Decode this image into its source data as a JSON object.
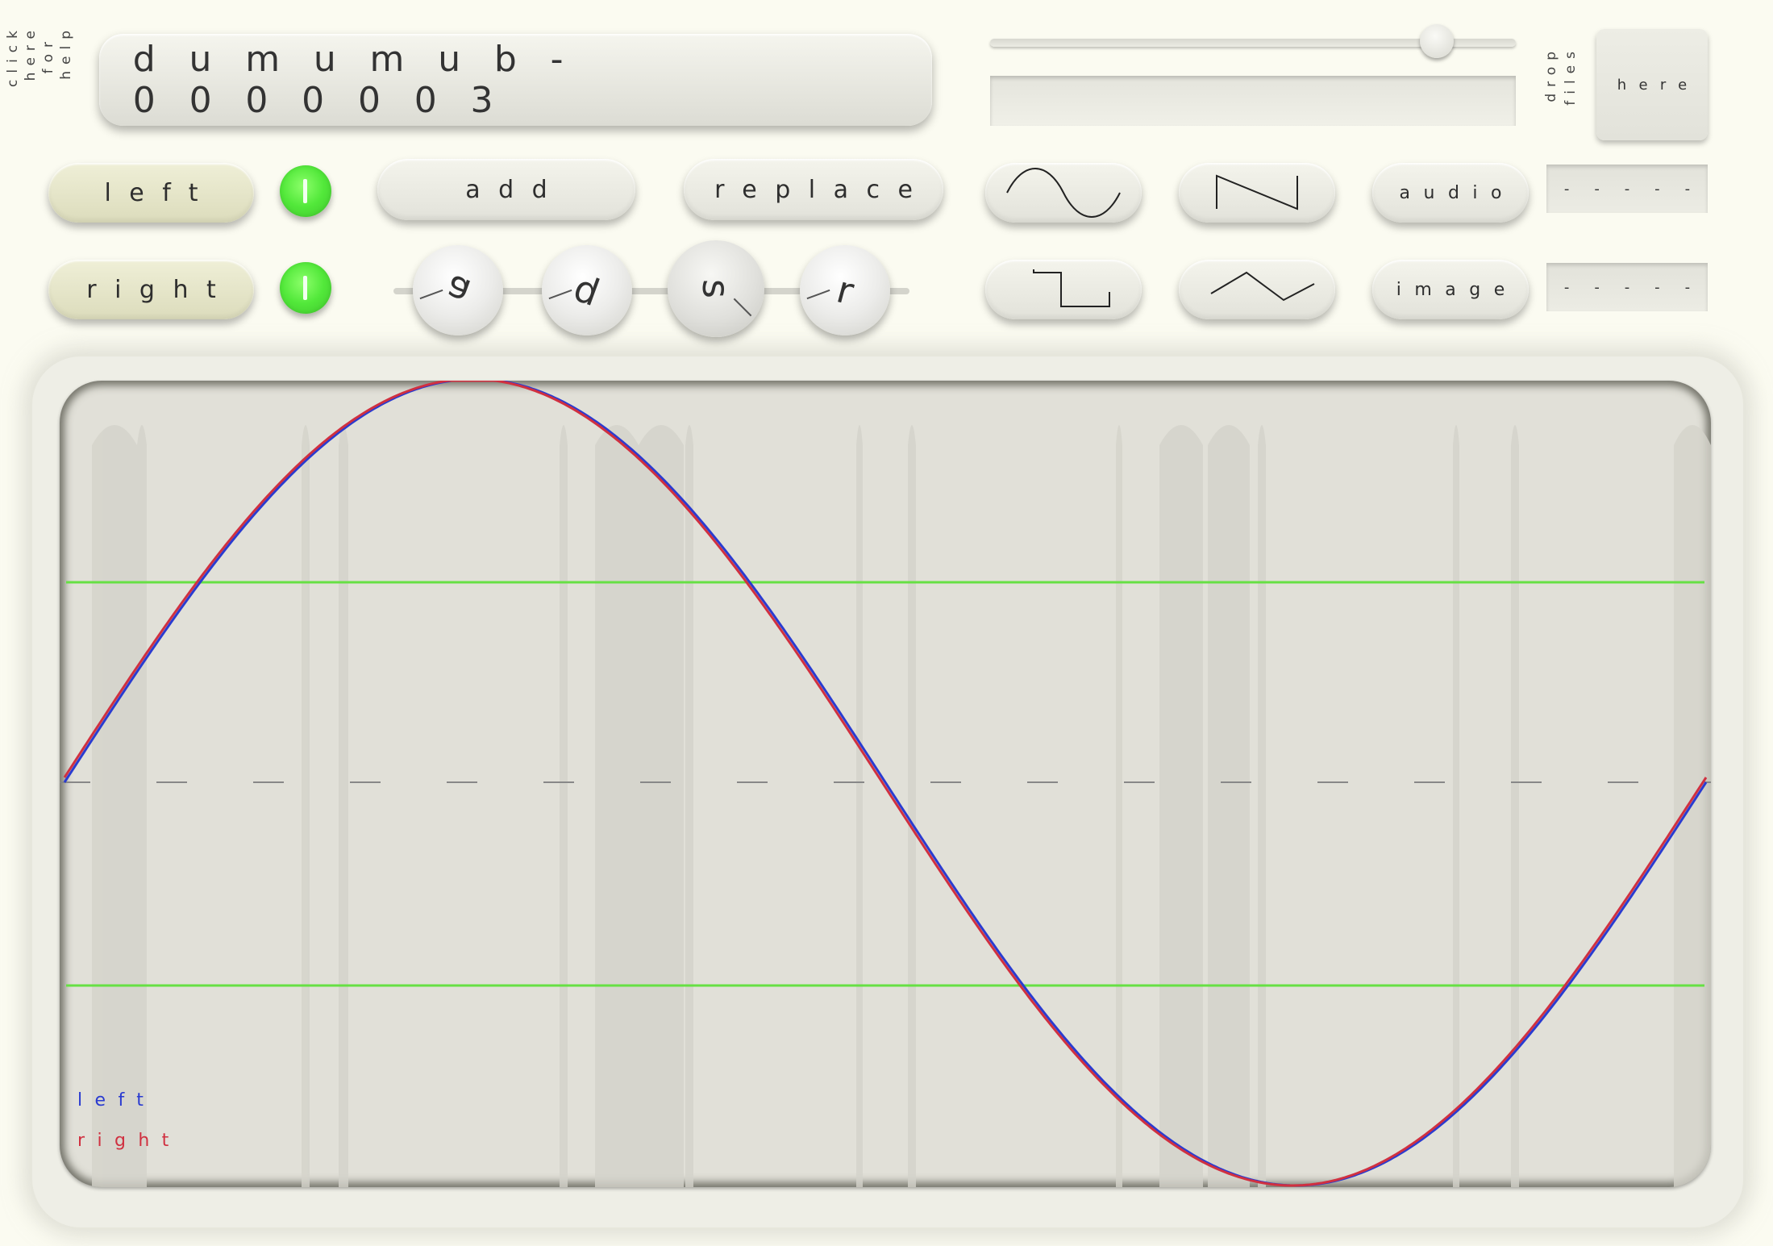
{
  "help": {
    "lines": [
      "click",
      "here",
      "for",
      "help"
    ]
  },
  "title": "dumumub-0000003",
  "slider": {
    "value": 0.85,
    "text": ""
  },
  "drop": {
    "lines": [
      "drop",
      "files"
    ],
    "here_label": "here"
  },
  "channels": {
    "left_label": "left",
    "right_label": "right",
    "left_enabled": true,
    "right_enabled": true
  },
  "actions": {
    "add_label": "add",
    "replace_label": "replace"
  },
  "envelope": {
    "labels": [
      "a",
      "d",
      "s",
      "r"
    ]
  },
  "waveforms": [
    "sine",
    "saw",
    "square",
    "triangle"
  ],
  "import": {
    "audio_label": "audio",
    "image_label": "image",
    "audio_file": "- - - - -",
    "image_file": "- - - - -"
  },
  "scope": {
    "legend_left": "left",
    "legend_right": "right",
    "colors": {
      "left": "#2a3bd0",
      "right": "#d03040",
      "guide": "#66e044",
      "grid": "#888"
    }
  }
}
